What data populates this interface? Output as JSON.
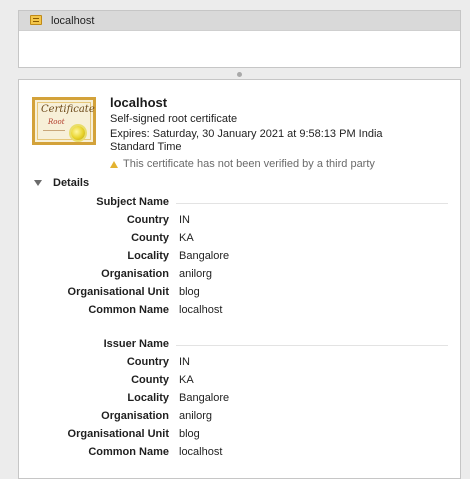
{
  "keychain_list": {
    "items": [
      {
        "label": "localhost",
        "icon": "certificate-icon"
      }
    ]
  },
  "certificate": {
    "art": {
      "title": "Certificate",
      "subtitle": "Root"
    },
    "name": "localhost",
    "kind": "Self-signed root certificate",
    "expires": "Expires: Saturday, 30 January 2021 at 9:58:13 PM India Standard Time",
    "warning": "This certificate has not been verified by a third party",
    "warning_color": "#e3b230"
  },
  "details": {
    "label": "Details",
    "subject": {
      "title": "Subject Name",
      "fields": [
        {
          "key": "Country",
          "value": "IN"
        },
        {
          "key": "County",
          "value": "KA"
        },
        {
          "key": "Locality",
          "value": "Bangalore"
        },
        {
          "key": "Organisation",
          "value": "anilorg"
        },
        {
          "key": "Organisational Unit",
          "value": "blog"
        },
        {
          "key": "Common Name",
          "value": "localhost"
        }
      ]
    },
    "issuer": {
      "title": "Issuer Name",
      "fields": [
        {
          "key": "Country",
          "value": "IN"
        },
        {
          "key": "County",
          "value": "KA"
        },
        {
          "key": "Locality",
          "value": "Bangalore"
        },
        {
          "key": "Organisation",
          "value": "anilorg"
        },
        {
          "key": "Organisational Unit",
          "value": "blog"
        },
        {
          "key": "Common Name",
          "value": "localhost"
        }
      ]
    }
  }
}
